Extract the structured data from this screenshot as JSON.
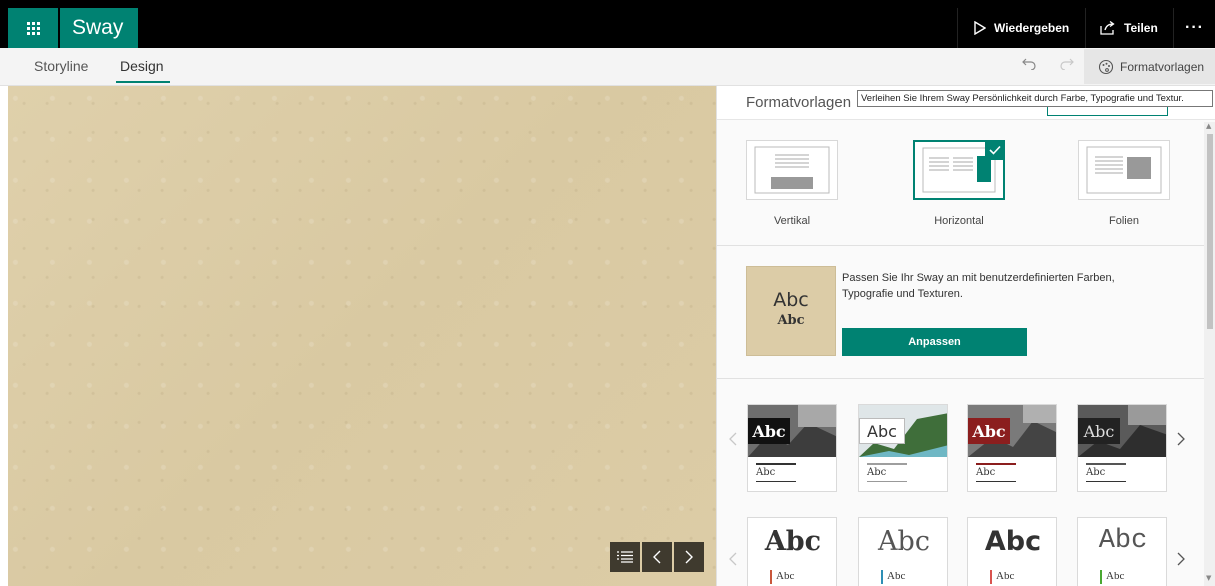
{
  "app": {
    "name": "Sway"
  },
  "topbar": {
    "play_label": "Wiedergeben",
    "share_label": "Teilen",
    "more_label": "···"
  },
  "tabs": [
    {
      "label": "Storyline",
      "active": false
    },
    {
      "label": "Design",
      "active": true
    }
  ],
  "toolbar": {
    "styles_label": "Formatvorlagen"
  },
  "pane": {
    "title": "Formatvorlagen",
    "tooltip": "Verleihen Sie Ihrem Sway Persönlichkeit durch Farbe, Typografie und Textur.",
    "layouts": [
      {
        "label": "Vertikal",
        "selected": false
      },
      {
        "label": "Horizontal",
        "selected": true
      },
      {
        "label": "Folien",
        "selected": false
      }
    ],
    "customize": {
      "text": "Passen Sie Ihr Sway an mit benutzerdefinierten Farben, Typografie und Texturen.",
      "button_label": "Anpassen",
      "thumb_abc_1": "Abc",
      "thumb_abc_2": "Abc"
    },
    "style_cards_row1": [
      {
        "abc": "Abc",
        "sub": "Abc",
        "accent": "#333333"
      },
      {
        "abc": "Abc",
        "sub": "Abc",
        "accent": "#9e9e9e"
      },
      {
        "abc": "Abc",
        "sub": "Abc",
        "accent": "#8b1e1e"
      },
      {
        "abc": "Abc",
        "sub": "Abc",
        "accent": "#555555"
      }
    ],
    "style_cards_row2": [
      {
        "abc": "Abc",
        "sub": "Abc",
        "color": "#333333",
        "accent": "#c9573c"
      },
      {
        "abc": "Abc",
        "sub": "Abc",
        "color": "#555555",
        "accent": "#2e8fb5"
      },
      {
        "abc": "Abc",
        "sub": "Abc",
        "color": "#333333",
        "accent": "#d9534f"
      },
      {
        "abc": "Abc",
        "sub": "Abc",
        "color": "#555555",
        "accent": "#4aa832"
      }
    ]
  },
  "colors": {
    "accent": "#008272",
    "topbar": "#000000",
    "canvas": "#dccca7"
  }
}
